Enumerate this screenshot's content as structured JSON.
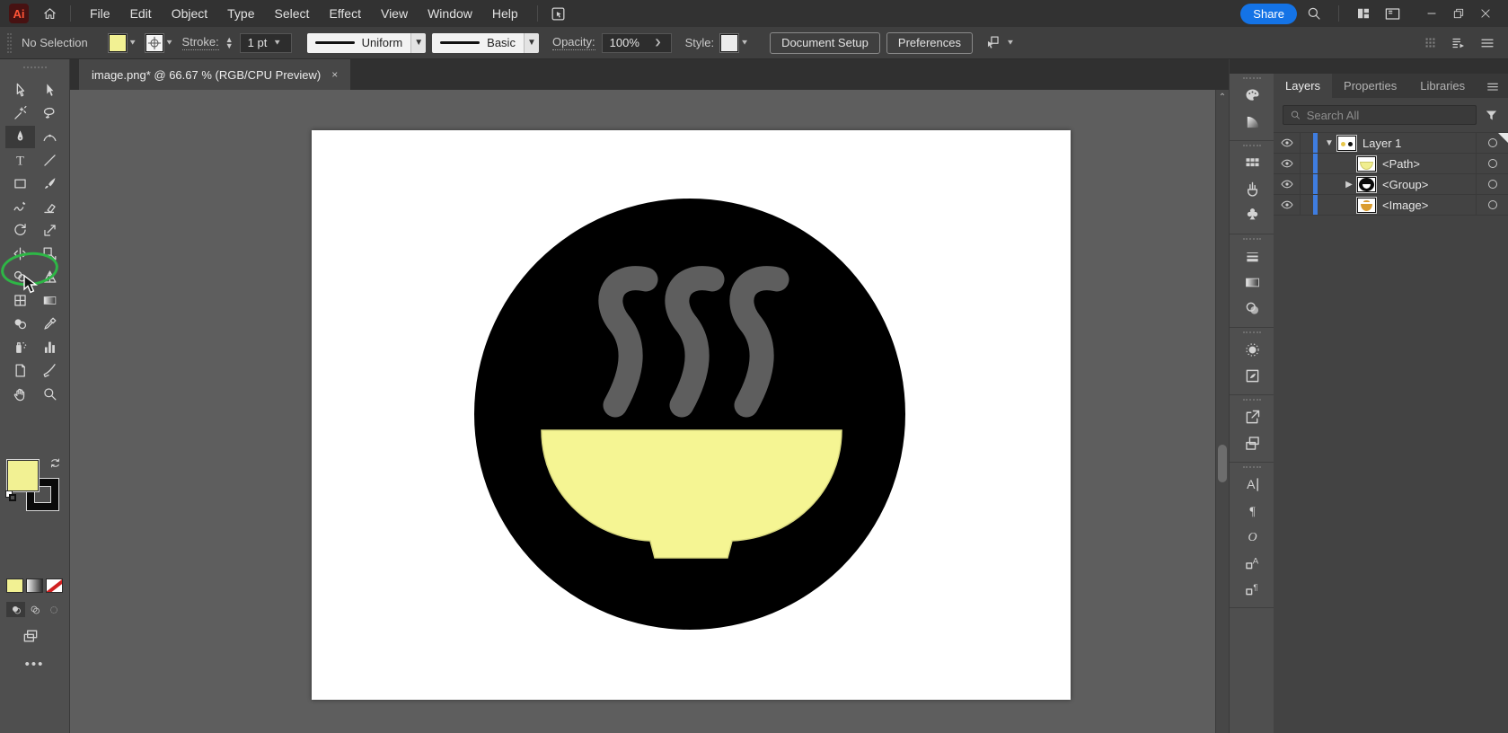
{
  "app": {
    "logo_text": "Ai"
  },
  "menubar": {
    "menus": [
      "File",
      "Edit",
      "Object",
      "Type",
      "Select",
      "Effect",
      "View",
      "Window",
      "Help"
    ],
    "share_label": "Share",
    "icons": [
      "home-icon",
      "touch-workspace-icon",
      "search-icon",
      "workspace-switcher-icon",
      "panels-icon"
    ],
    "window_controls": [
      "minimize",
      "restore",
      "close"
    ]
  },
  "control_bar": {
    "selection_status": "No Selection",
    "fill_color": "#f2f193",
    "stroke_label": "Stroke:",
    "stroke_weight": "1 pt",
    "width_profile": "Uniform",
    "brush_definition": "Basic",
    "opacity_label": "Opacity:",
    "opacity_value": "100%",
    "style_label": "Style:",
    "document_setup_label": "Document Setup",
    "preferences_label": "Preferences"
  },
  "document_tab": {
    "title": "image.png* @ 66.67 % (RGB/CPU Preview)",
    "close_glyph": "×"
  },
  "tools": [
    {
      "name": "selection",
      "icon": "arrow-outline"
    },
    {
      "name": "direct-selection",
      "icon": "arrow-filled"
    },
    {
      "name": "magic-wand",
      "icon": "magic-wand"
    },
    {
      "name": "lasso",
      "icon": "lasso"
    },
    {
      "name": "pen",
      "icon": "pen",
      "selected": true,
      "annotated": "green-circle"
    },
    {
      "name": "curvature",
      "icon": "curvature"
    },
    {
      "name": "type",
      "icon": "type"
    },
    {
      "name": "line-segment",
      "icon": "line"
    },
    {
      "name": "rectangle",
      "icon": "rectangle"
    },
    {
      "name": "paintbrush",
      "icon": "paintbrush"
    },
    {
      "name": "shaper",
      "icon": "shaper"
    },
    {
      "name": "eraser",
      "icon": "eraser"
    },
    {
      "name": "rotate",
      "icon": "rotate"
    },
    {
      "name": "scale",
      "icon": "scale"
    },
    {
      "name": "width",
      "icon": "width"
    },
    {
      "name": "free-transform",
      "icon": "free-transform"
    },
    {
      "name": "shape-builder",
      "icon": "shape-builder"
    },
    {
      "name": "perspective-grid",
      "icon": "perspective-grid"
    },
    {
      "name": "mesh",
      "icon": "mesh"
    },
    {
      "name": "gradient",
      "icon": "gradient"
    },
    {
      "name": "blend",
      "icon": "blend"
    },
    {
      "name": "eyedropper",
      "icon": "eyedropper"
    },
    {
      "name": "symbol-sprayer",
      "icon": "symbol-sprayer"
    },
    {
      "name": "column-graph",
      "icon": "column-graph"
    },
    {
      "name": "artboard",
      "icon": "artboard"
    },
    {
      "name": "slice",
      "icon": "slice"
    },
    {
      "name": "hand",
      "icon": "hand"
    },
    {
      "name": "zoom",
      "icon": "zoom"
    }
  ],
  "toolbar_swatches": {
    "fill": "#f2f193",
    "stroke": "#000000"
  },
  "dock_panels": [
    [
      "color",
      "color-guide"
    ],
    [
      "swatches",
      "brushes",
      "symbols"
    ],
    [
      "stroke",
      "gradient",
      "transparency"
    ],
    [
      "appearance",
      "graphic-styles"
    ],
    [
      "asset-export",
      "artboards"
    ],
    [
      "character",
      "paragraph",
      "opentype",
      "character-styles",
      "paragraph-styles"
    ]
  ],
  "layers_panel": {
    "tabs": [
      {
        "label": "Layers",
        "active": true
      },
      {
        "label": "Properties",
        "active": false
      },
      {
        "label": "Libraries",
        "active": false
      }
    ],
    "search_placeholder": "Search All",
    "rows": [
      {
        "label": "Layer 1",
        "expander": "down",
        "thumb": "layer",
        "selected": true
      },
      {
        "label": "<Path>",
        "expander": "",
        "thumb": "path"
      },
      {
        "label": "<Group>",
        "expander": "right",
        "thumb": "group"
      },
      {
        "label": "<Image>",
        "expander": "",
        "thumb": "image"
      }
    ]
  },
  "canvas": {
    "artboard_color": "#ffffff",
    "pasteboard_color": "#5e5e5e",
    "soup_icon": {
      "circle": "#000000",
      "bowl": "#f5f593",
      "steam": "#5e5e5e"
    }
  },
  "annotation": {
    "highlight_color": "#2eb646"
  }
}
